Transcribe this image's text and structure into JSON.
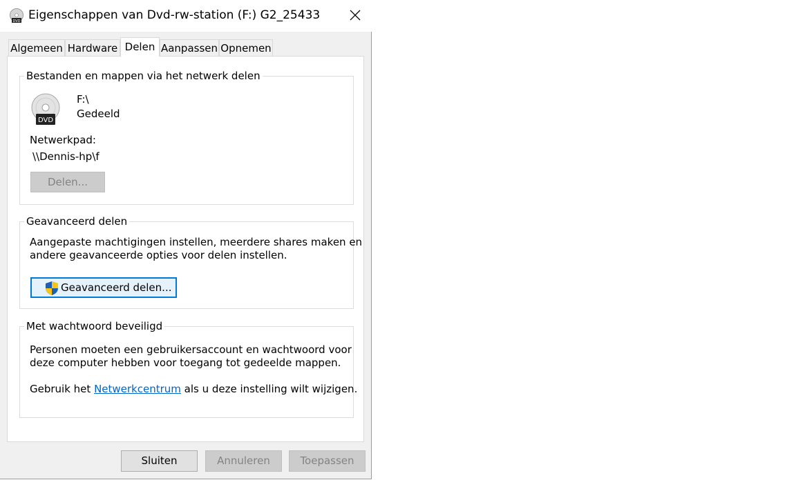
{
  "window": {
    "title": "Eigenschappen van Dvd-rw-station (F:) G2_25433",
    "close_label": "×"
  },
  "tabs": [
    {
      "label": "Algemeen",
      "active": false
    },
    {
      "label": "Hardware",
      "active": false
    },
    {
      "label": "Delen",
      "active": true
    },
    {
      "label": "Aanpassen",
      "active": false
    },
    {
      "label": "Opnemen",
      "active": false
    }
  ],
  "share_group": {
    "title": "Bestanden en mappen via het netwerk delen",
    "drive_name": "F:\\",
    "drive_status": "Gedeeld",
    "icon_label": "DVD",
    "network_path_label": "Netwerkpad:",
    "network_path_value": "\\\\Dennis-hp\\f",
    "share_button": "Delen..."
  },
  "advanced_group": {
    "title": "Geavanceerd delen",
    "desc_line1": "Aangepaste machtigingen instellen, meerdere shares maken en",
    "desc_line2": "andere geavanceerde opties voor delen instellen.",
    "button": "Geavanceerd delen..."
  },
  "password_group": {
    "title": "Met wachtwoord beveiligd",
    "line1": "Personen moeten een gebruikersaccount en wachtwoord voor",
    "line2": "deze computer hebben voor toegang tot gedeelde mappen.",
    "line3_prefix": "Gebruik het ",
    "line3_link": "Netwerkcentrum",
    "line3_suffix": " als u deze instelling wilt wijzigen."
  },
  "footer": {
    "close": "Sluiten",
    "cancel": "Annuleren",
    "apply": "Toepassen"
  },
  "colors": {
    "accent": "#0078d7",
    "link": "#0066cc",
    "shield_blue": "#1e5fb4",
    "shield_yellow": "#f5c518"
  }
}
